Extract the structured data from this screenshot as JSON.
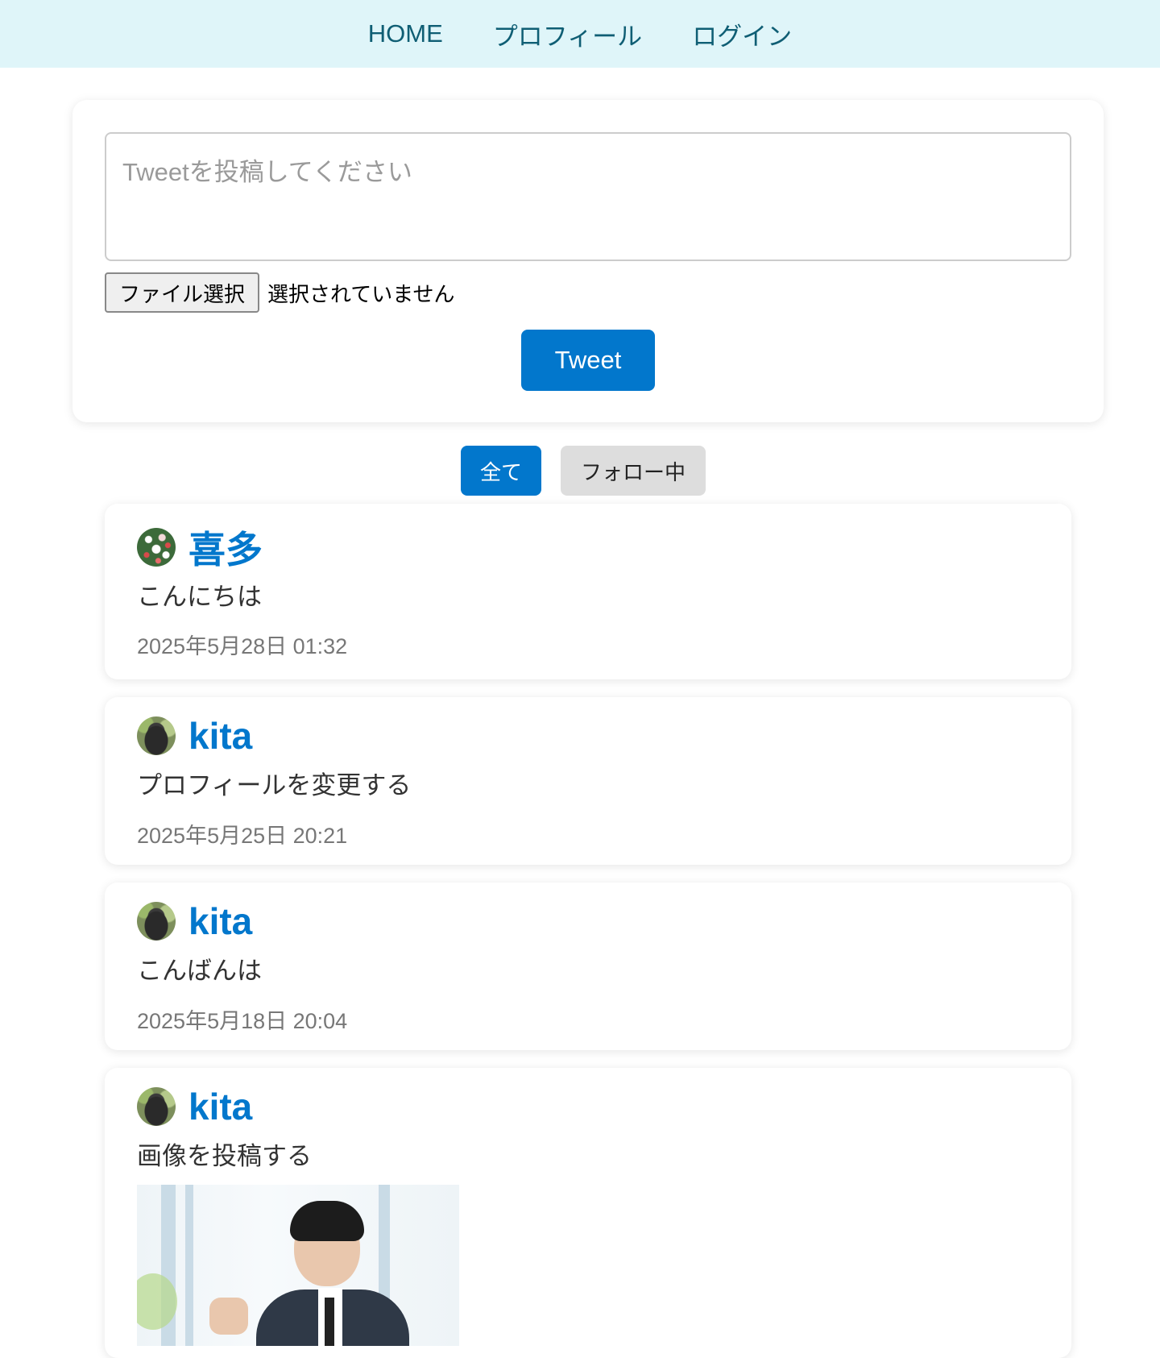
{
  "nav": {
    "home": "HOME",
    "profile": "プロフィール",
    "login": "ログイン"
  },
  "composer": {
    "placeholder": "Tweetを投稿してください",
    "file_button": "ファイル選択",
    "file_status": "選択されていません",
    "submit": "Tweet"
  },
  "filters": {
    "all": "全て",
    "following": "フォロー中"
  },
  "tweets": [
    {
      "user": "喜多",
      "avatar": "flowers-avatar",
      "text": "こんにちは",
      "time": "2025年5月28日 01:32"
    },
    {
      "user": "kita",
      "avatar": "gorilla-avatar",
      "text": "プロフィールを変更する",
      "time": "2025年5月25日 20:21"
    },
    {
      "user": "kita",
      "avatar": "gorilla-avatar",
      "text": "こんばんは",
      "time": "2025年5月18日 20:04"
    },
    {
      "user": "kita",
      "avatar": "gorilla-avatar",
      "text": "画像を投稿する",
      "image": "businessman-photo"
    }
  ],
  "colors": {
    "nav_background": "#dff5f9",
    "nav_text": "#0f5e74",
    "accent": "#0277cc",
    "inactive_button": "#dddddd"
  }
}
